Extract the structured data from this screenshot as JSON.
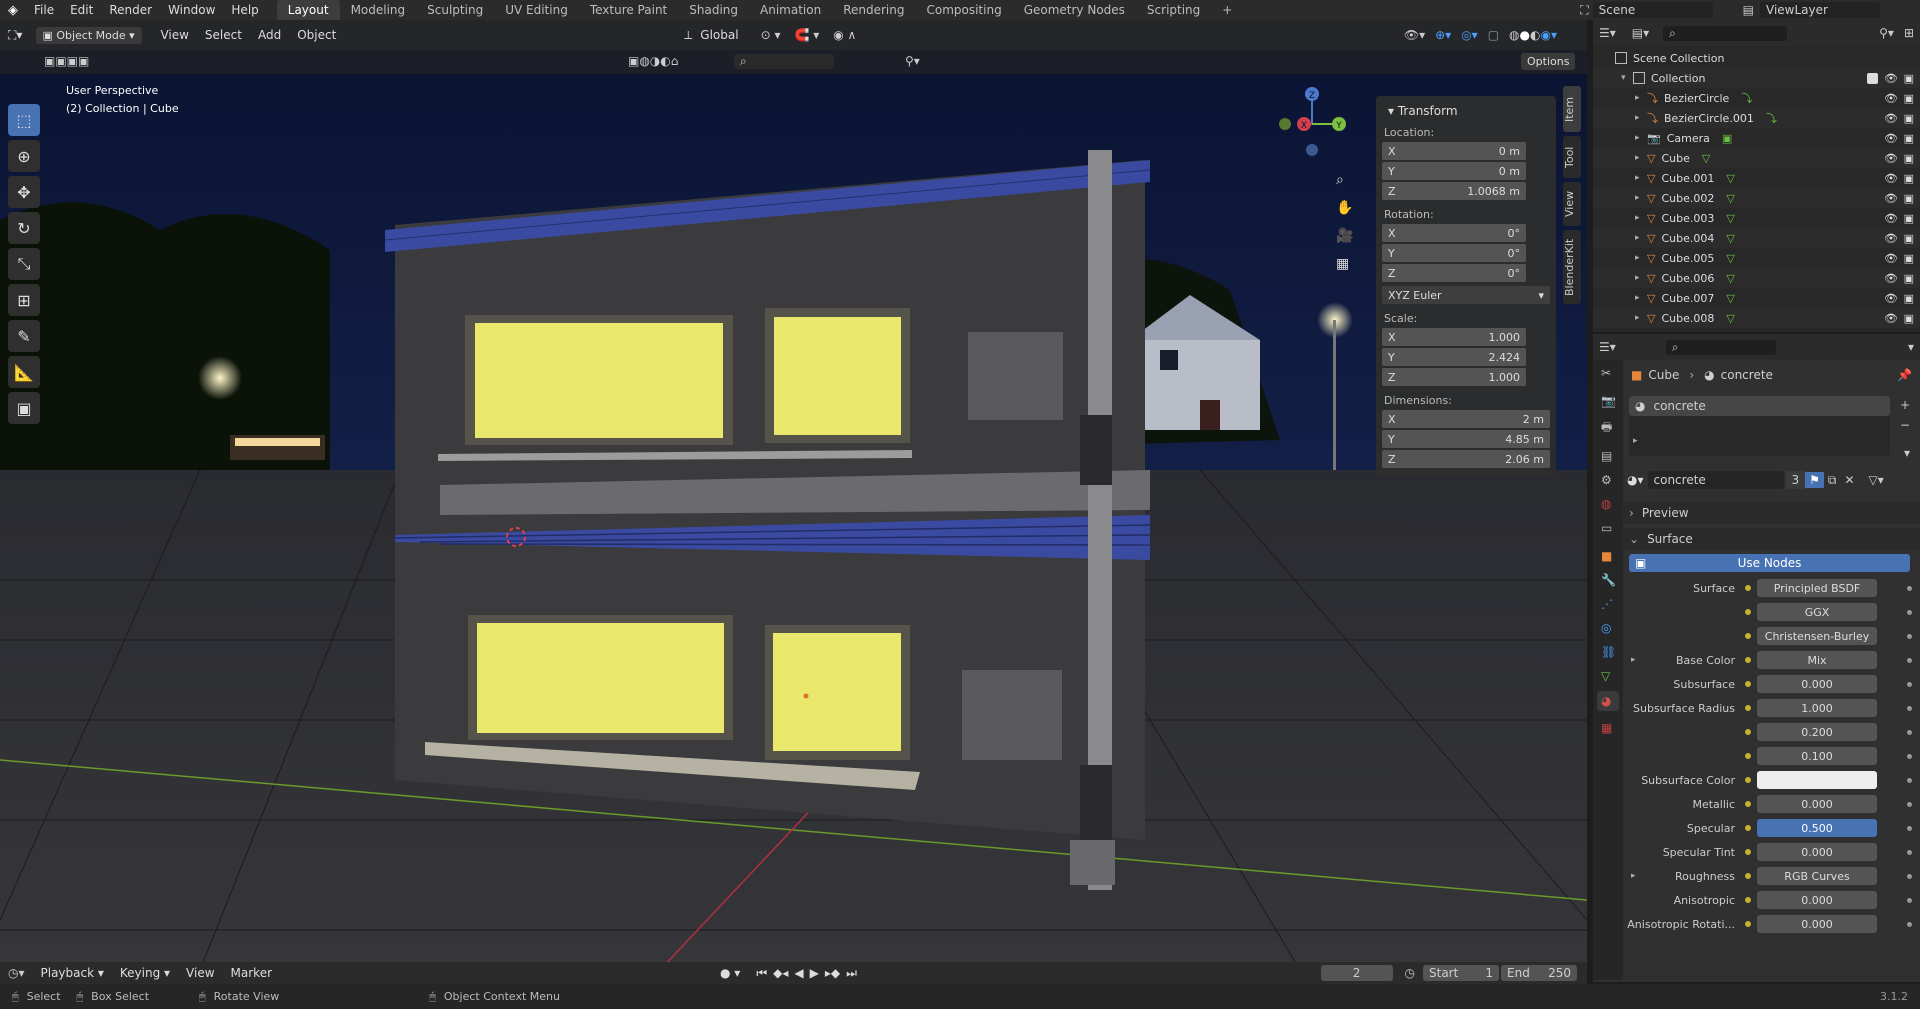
{
  "menu": [
    "File",
    "Edit",
    "Render",
    "Window",
    "Help"
  ],
  "workspaces": [
    "Layout",
    "Modeling",
    "Sculpting",
    "UV Editing",
    "Texture Paint",
    "Shading",
    "Animation",
    "Rendering",
    "Compositing",
    "Geometry Nodes",
    "Scripting"
  ],
  "scene": "Scene",
  "view_layer": "ViewLayer",
  "viewport": {
    "mode": "Object Mode",
    "menus": [
      "View",
      "Select",
      "Add",
      "Object"
    ],
    "orientation": "Global",
    "options_label": "Options",
    "overlay_title": "User Perspective",
    "overlay_subtitle": "(2) Collection | Cube"
  },
  "transform": {
    "title": "Transform",
    "location_label": "Location:",
    "location": {
      "x": "0 m",
      "y": "0 m",
      "z": "1.0068 m"
    },
    "rotation_label": "Rotation:",
    "rotation": {
      "x": "0°",
      "y": "0°",
      "z": "0°"
    },
    "rotation_mode": "XYZ Euler",
    "scale_label": "Scale:",
    "scale": {
      "x": "1.000",
      "y": "2.424",
      "z": "1.000"
    },
    "dimensions_label": "Dimensions:",
    "dimensions": {
      "x": "2 m",
      "y": "4.85 m",
      "z": "2.06 m"
    }
  },
  "side_tabs": [
    "Item",
    "Tool",
    "View",
    "BlenderKit"
  ],
  "outliner": {
    "scene_collection": "Scene Collection",
    "collection": "Collection",
    "items": [
      "BezierCircle",
      "BezierCircle.001",
      "Camera",
      "Cube",
      "Cube.001",
      "Cube.002",
      "Cube.003",
      "Cube.004",
      "Cube.005",
      "Cube.006",
      "Cube.007",
      "Cube.008"
    ]
  },
  "properties": {
    "breadcrumb_object": "Cube",
    "breadcrumb_material": "concrete",
    "slot": "concrete",
    "material_name": "concrete",
    "users": "3",
    "preview": "Preview",
    "surface_section": "Surface",
    "use_nodes": "Use Nodes",
    "rows": [
      {
        "label": "Surface",
        "value": "Principled BSDF"
      },
      {
        "label": "",
        "value": "GGX"
      },
      {
        "label": "",
        "value": "Christensen-Burley"
      },
      {
        "label": "Base Color",
        "value": "Mix"
      },
      {
        "label": "Subsurface",
        "value": "0.000"
      },
      {
        "label": "Subsurface Radius",
        "value": "1.000"
      },
      {
        "label": "",
        "value": "0.200"
      },
      {
        "label": "",
        "value": "0.100"
      },
      {
        "label": "Subsurface Color",
        "value": ""
      },
      {
        "label": "Metallic",
        "value": "0.000"
      },
      {
        "label": "Specular",
        "value": "0.500"
      },
      {
        "label": "Specular Tint",
        "value": "0.000"
      },
      {
        "label": "Roughness",
        "value": "RGB Curves"
      },
      {
        "label": "Anisotropic",
        "value": "0.000"
      },
      {
        "label": "Anisotropic Rotati...",
        "value": "0.000"
      }
    ]
  },
  "timeline": {
    "menus": [
      "Playback",
      "Keying",
      "View",
      "Marker"
    ],
    "current_frame": "2",
    "start_label": "Start",
    "start": "1",
    "end_label": "End",
    "end": "250"
  },
  "status": {
    "select": "Select",
    "box_select": "Box Select",
    "rotate_view": "Rotate View",
    "context_menu": "Object Context Menu",
    "version": "3.1.2"
  },
  "colors": {
    "accent": "#4772b3",
    "window_glow": "#e9e86d",
    "roof": "#3a4aa0",
    "outliner_orange": "#e5883c"
  }
}
